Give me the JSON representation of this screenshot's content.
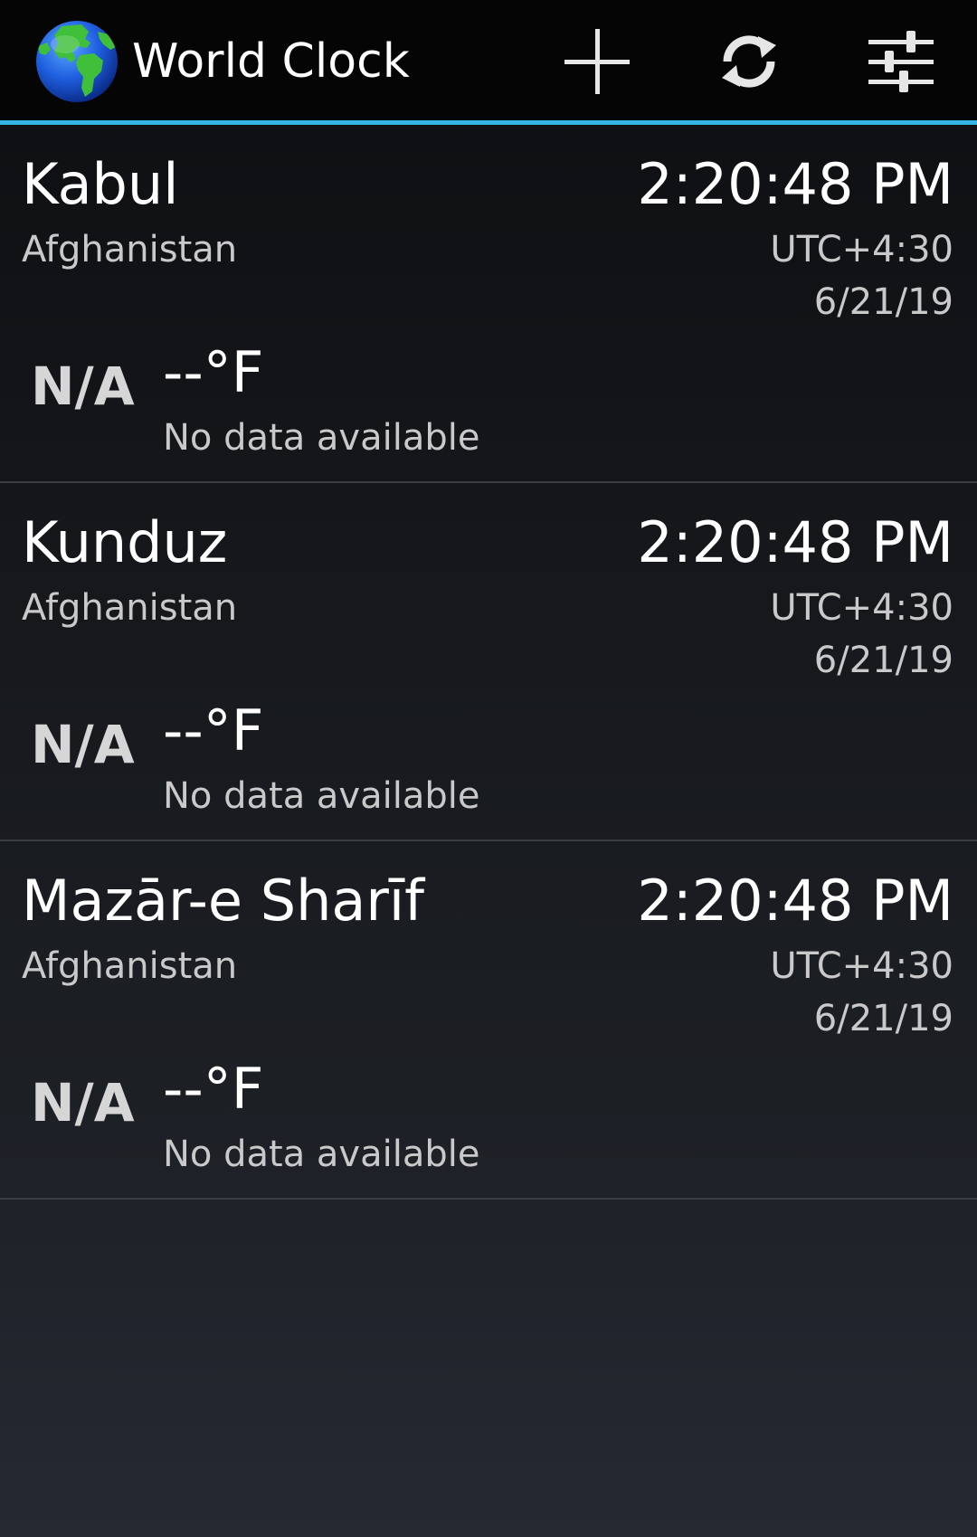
{
  "app": {
    "title": "World Clock",
    "icon": "globe-icon",
    "accent_color": "#33b5e5"
  },
  "actions": [
    {
      "name": "add-city-button",
      "icon": "plus-icon"
    },
    {
      "name": "refresh-button",
      "icon": "refresh-icon"
    },
    {
      "name": "settings-button",
      "icon": "sliders-icon"
    }
  ],
  "cities": [
    {
      "name": "Kabul",
      "country": "Afghanistan",
      "time": "2:20:48 PM",
      "utc_offset": "UTC+4:30",
      "date": "6/21/19",
      "weather_icon_text": "N/A",
      "temperature": "--°F",
      "weather_description": "No data available"
    },
    {
      "name": "Kunduz",
      "country": "Afghanistan",
      "time": "2:20:48 PM",
      "utc_offset": "UTC+4:30",
      "date": "6/21/19",
      "weather_icon_text": "N/A",
      "temperature": "--°F",
      "weather_description": "No data available"
    },
    {
      "name": "Mazār-e Sharīf",
      "country": "Afghanistan",
      "time": "2:20:48 PM",
      "utc_offset": "UTC+4:30",
      "date": "6/21/19",
      "weather_icon_text": "N/A",
      "temperature": "--°F",
      "weather_description": "No data available"
    }
  ]
}
